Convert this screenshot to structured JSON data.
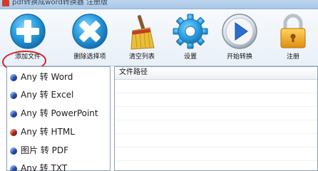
{
  "window": {
    "title": "pdf转换成word转换器 注册版"
  },
  "toolbar": {
    "buttons": [
      {
        "label": "添加文件",
        "icon": "plus-icon",
        "color": "#2a9fe0"
      },
      {
        "label": "删除选择项",
        "icon": "close-icon",
        "color": "#2a9fe0"
      },
      {
        "label": "清空列表",
        "icon": "broom-icon",
        "color": "#e2b22a"
      },
      {
        "label": "设置",
        "icon": "gear-icon",
        "color": "#2a9fe0"
      },
      {
        "label": "开始转换",
        "icon": "play-icon",
        "color": "#2a6fd0"
      },
      {
        "label": "注册",
        "icon": "lock-icon",
        "color": "#e8a51d"
      }
    ]
  },
  "conversion_list": {
    "items": [
      {
        "label": "Any 转 Word",
        "dot_color": "#2b5cc9"
      },
      {
        "label": "Any 转 Excel",
        "dot_color": "#2b5cc9"
      },
      {
        "label": "Any 转 PowerPoint",
        "dot_color": "#2b5cc9"
      },
      {
        "label": "Any 转 HTML",
        "dot_color": "#c62a1f"
      },
      {
        "label": "图片 转 PDF",
        "dot_color": "#2b5cc9"
      },
      {
        "label": "Any 转 TXT",
        "dot_color": "#2b5cc9"
      }
    ]
  },
  "file_table": {
    "header": "文件路径"
  }
}
